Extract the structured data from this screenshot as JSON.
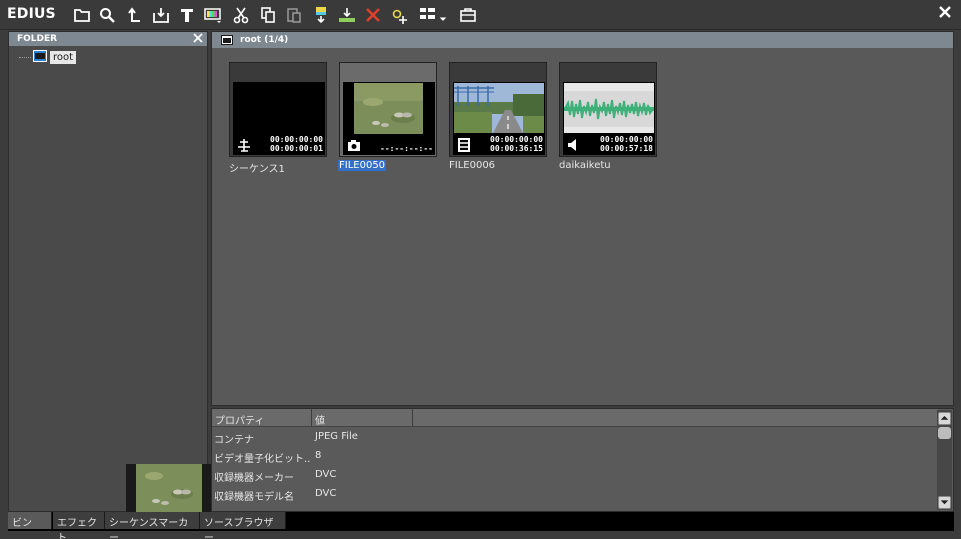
{
  "app": {
    "name": "EDIUS"
  },
  "toolbar": {
    "icons": [
      "folder-icon",
      "search-icon",
      "up-level-icon",
      "import-icon",
      "title-icon",
      "color-bar-icon",
      "cut-icon",
      "copy-icon",
      "paste-icon",
      "add-to-timeline-icon",
      "insert-icon",
      "delete-icon",
      "properties-icon",
      "view-icon",
      "bin-icon"
    ]
  },
  "folder_panel": {
    "title": "FOLDER",
    "root_label": "root"
  },
  "bin": {
    "path_title": "root (1/4)",
    "clips": [
      {
        "name": "シーケンス1",
        "tc_in": "00:00:00:00",
        "tc_dur": "00:00:00:01",
        "type": "sequence-icon",
        "selected": false
      },
      {
        "name": "FILE0050",
        "tc_in": "",
        "tc_dur": "--:--:--:--",
        "type": "still-image-icon",
        "selected": true
      },
      {
        "name": "FILE0006",
        "tc_in": "00:00:00:00",
        "tc_dur": "00:00:36:15",
        "type": "video-clip-icon",
        "selected": false
      },
      {
        "name": "daikaiketu",
        "tc_in": "00:00:00:00",
        "tc_dur": "00:00:57:18",
        "type": "audio-clip-icon",
        "selected": false
      }
    ]
  },
  "properties": {
    "col_property": "プロパティ",
    "col_value": "値",
    "rows": [
      {
        "key": "コンテナ",
        "value": "JPEG File"
      },
      {
        "key": "ビデオ量子化ビット...",
        "value": "8"
      },
      {
        "key": "収録機器メーカー",
        "value": "DVC"
      },
      {
        "key": "収録機器モデル名",
        "value": "DVC"
      }
    ]
  },
  "bottom_tabs": [
    "ビン",
    "エフェクト",
    "シーケンスマーカー",
    "ソースブラウザー"
  ],
  "colors": {
    "header": "#7e8890",
    "selection": "#3470c8",
    "delete": "#e0402a"
  }
}
